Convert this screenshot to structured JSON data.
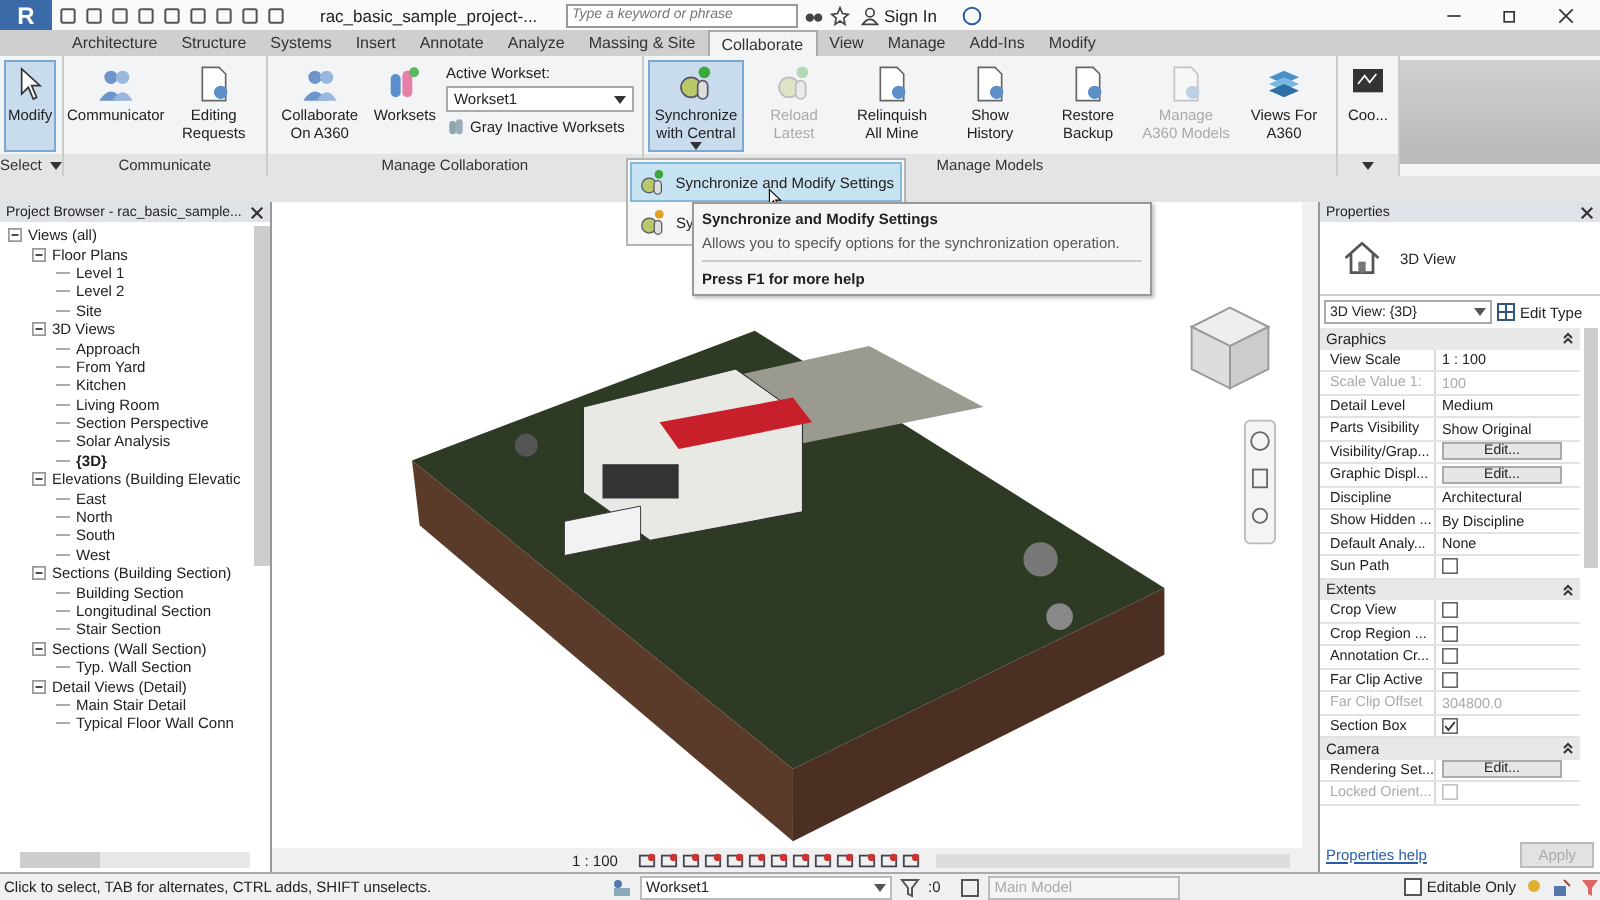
{
  "app_button": {
    "label": "R"
  },
  "title_bar": {
    "title": "rac_basic_sample_project-...",
    "search": {
      "placeholder": "Type a keyword or phrase"
    },
    "sign_in": "Sign In"
  },
  "tabs": [
    {
      "label": "Architecture",
      "selected": false
    },
    {
      "label": "Structure",
      "selected": false
    },
    {
      "label": "Systems",
      "selected": false
    },
    {
      "label": "Insert",
      "selected": false
    },
    {
      "label": "Annotate",
      "selected": false
    },
    {
      "label": "Analyze",
      "selected": false
    },
    {
      "label": "Massing & Site",
      "selected": false
    },
    {
      "label": "Collaborate",
      "selected": true
    },
    {
      "label": "View",
      "selected": false
    },
    {
      "label": "Manage",
      "selected": false
    },
    {
      "label": "Add-Ins",
      "selected": false
    },
    {
      "label": "Modify",
      "selected": false
    }
  ],
  "ribbon": {
    "panels": [
      {
        "label": "Select",
        "dropdown": true,
        "buttons": [
          {
            "label": "Modify",
            "selected": true,
            "disabled": false
          }
        ]
      },
      {
        "label": "Communicate",
        "buttons": [
          {
            "label": "Communicator",
            "selected": false,
            "disabled": false
          },
          {
            "label": "Editing Requests",
            "selected": false,
            "disabled": false
          }
        ]
      },
      {
        "label": "Manage Collaboration",
        "buttons": [
          {
            "label": "Collaborate On A360",
            "selected": false,
            "disabled": false
          },
          {
            "label": "Worksets",
            "selected": false,
            "disabled": false
          }
        ],
        "workset": {
          "label": "Active Workset:",
          "value": "Workset1",
          "gray_button": "Gray Inactive Worksets"
        }
      },
      {
        "label": "Manage Models",
        "buttons": [
          {
            "label": "Synchronize with Central",
            "selected": true,
            "disabled": false,
            "dropdown": true
          },
          {
            "label": "Reload Latest",
            "selected": false,
            "disabled": true
          },
          {
            "label": "Relinquish All Mine",
            "selected": false,
            "disabled": false
          },
          {
            "label": "Show History",
            "selected": false,
            "disabled": false
          },
          {
            "label": "Restore Backup",
            "selected": false,
            "disabled": false
          },
          {
            "label": "Manage A360 Models",
            "selected": false,
            "disabled": true
          },
          {
            "label": "Views For A360",
            "selected": false,
            "disabled": false
          }
        ]
      },
      {
        "dropdown": true,
        "buttons": [
          {
            "label": "Coo...",
            "selected": false,
            "disabled": false
          }
        ]
      }
    ]
  },
  "sync_menu": {
    "items": [
      {
        "label": "Synchronize and Modify Settings",
        "selected": true
      },
      {
        "label": "Sy",
        "selected": false
      }
    ]
  },
  "tooltip": {
    "title": "Synchronize and Modify Settings",
    "description": "Allows you to specify options for the synchronization operation.",
    "help": "Press F1 for more help"
  },
  "browser": {
    "title": "Project Browser - rac_basic_sample...",
    "tree": [
      {
        "label": "Views (all)",
        "expanded": true,
        "selected": false,
        "children": [
          {
            "label": "Floor Plans",
            "expanded": true,
            "selected": false,
            "children": [
              {
                "label": "Level 1",
                "selected": false
              },
              {
                "label": "Level 2",
                "selected": false
              },
              {
                "label": "Site",
                "selected": false
              }
            ]
          },
          {
            "label": "3D Views",
            "expanded": true,
            "selected": false,
            "children": [
              {
                "label": "Approach",
                "selected": false
              },
              {
                "label": "From Yard",
                "selected": false
              },
              {
                "label": "Kitchen",
                "selected": false
              },
              {
                "label": "Living Room",
                "selected": false
              },
              {
                "label": "Section Perspective",
                "selected": false
              },
              {
                "label": "Solar Analysis",
                "selected": false
              },
              {
                "label": "{3D}",
                "selected": true
              }
            ]
          },
          {
            "label": "Elevations (Building Elevatic",
            "expanded": true,
            "selected": false,
            "children": [
              {
                "label": "East",
                "selected": false
              },
              {
                "label": "North",
                "selected": false
              },
              {
                "label": "South",
                "selected": false
              },
              {
                "label": "West",
                "selected": false
              }
            ]
          },
          {
            "label": "Sections (Building Section)",
            "expanded": true,
            "selected": false,
            "children": [
              {
                "label": "Building Section",
                "selected": false
              },
              {
                "label": "Longitudinal Section",
                "selected": false
              },
              {
                "label": "Stair Section",
                "selected": false
              }
            ]
          },
          {
            "label": "Sections (Wall Section)",
            "expanded": true,
            "selected": false,
            "children": [
              {
                "label": "Typ. Wall Section",
                "selected": false
              }
            ]
          },
          {
            "label": "Detail Views (Detail)",
            "expanded": true,
            "selected": false,
            "children": [
              {
                "label": "Main Stair Detail",
                "selected": false
              },
              {
                "label": "Typical Floor Wall Conn",
                "selected": false
              }
            ]
          }
        ]
      }
    ]
  },
  "view": {
    "scale": "1 : 100"
  },
  "properties": {
    "title": "Properties",
    "type_name": "3D View",
    "selector": "3D View: {3D}",
    "edit_type": "Edit Type",
    "groups": [
      {
        "label": "Graphics",
        "rows": [
          {
            "name": "View Scale",
            "kind": "text",
            "value": "1 : 100",
            "disabled": false
          },
          {
            "name": "Scale Value    1:",
            "kind": "text",
            "value": "100",
            "disabled": true
          },
          {
            "name": "Detail Level",
            "kind": "text",
            "value": "Medium",
            "disabled": false
          },
          {
            "name": "Parts Visibility",
            "kind": "text",
            "value": "Show Original",
            "disabled": false
          },
          {
            "name": "Visibility/Grap...",
            "kind": "button",
            "value": "Edit...",
            "disabled": false
          },
          {
            "name": "Graphic Displ...",
            "kind": "button",
            "value": "Edit...",
            "disabled": false
          },
          {
            "name": "Discipline",
            "kind": "text",
            "value": "Architectural",
            "disabled": false
          },
          {
            "name": "Show Hidden ...",
            "kind": "text",
            "value": "By Discipline",
            "disabled": false
          },
          {
            "name": "Default Analy...",
            "kind": "text",
            "value": "None",
            "disabled": false
          },
          {
            "name": "Sun Path",
            "kind": "checkbox",
            "checked": false,
            "disabled": false
          }
        ]
      },
      {
        "label": "Extents",
        "rows": [
          {
            "name": "Crop View",
            "kind": "checkbox",
            "checked": false,
            "disabled": false
          },
          {
            "name": "Crop Region ...",
            "kind": "checkbox",
            "checked": false,
            "disabled": false
          },
          {
            "name": "Annotation Cr...",
            "kind": "checkbox",
            "checked": false,
            "disabled": false
          },
          {
            "name": "Far Clip Active",
            "kind": "checkbox",
            "checked": false,
            "disabled": false
          },
          {
            "name": "Far Clip Offset",
            "kind": "text",
            "value": "304800.0",
            "disabled": true
          },
          {
            "name": "Section Box",
            "kind": "checkbox",
            "checked": true,
            "disabled": false
          }
        ]
      },
      {
        "label": "Camera",
        "rows": [
          {
            "name": "Rendering Set...",
            "kind": "button",
            "value": "Edit...",
            "disabled": false
          },
          {
            "name": "Locked Orient...",
            "kind": "checkbox",
            "checked": false,
            "disabled": true
          }
        ]
      }
    ],
    "help_link": "Properties help",
    "apply": {
      "label": "Apply",
      "disabled": true
    }
  },
  "status_bar": {
    "message": "Click to select, TAB for alternates, CTRL adds, SHIFT unselects.",
    "workset": "Workset1",
    "filter_count": ":0",
    "design_option": {
      "label": "Main Model",
      "disabled": true
    },
    "editable_only": {
      "label": "Editable Only",
      "checked": false
    }
  }
}
